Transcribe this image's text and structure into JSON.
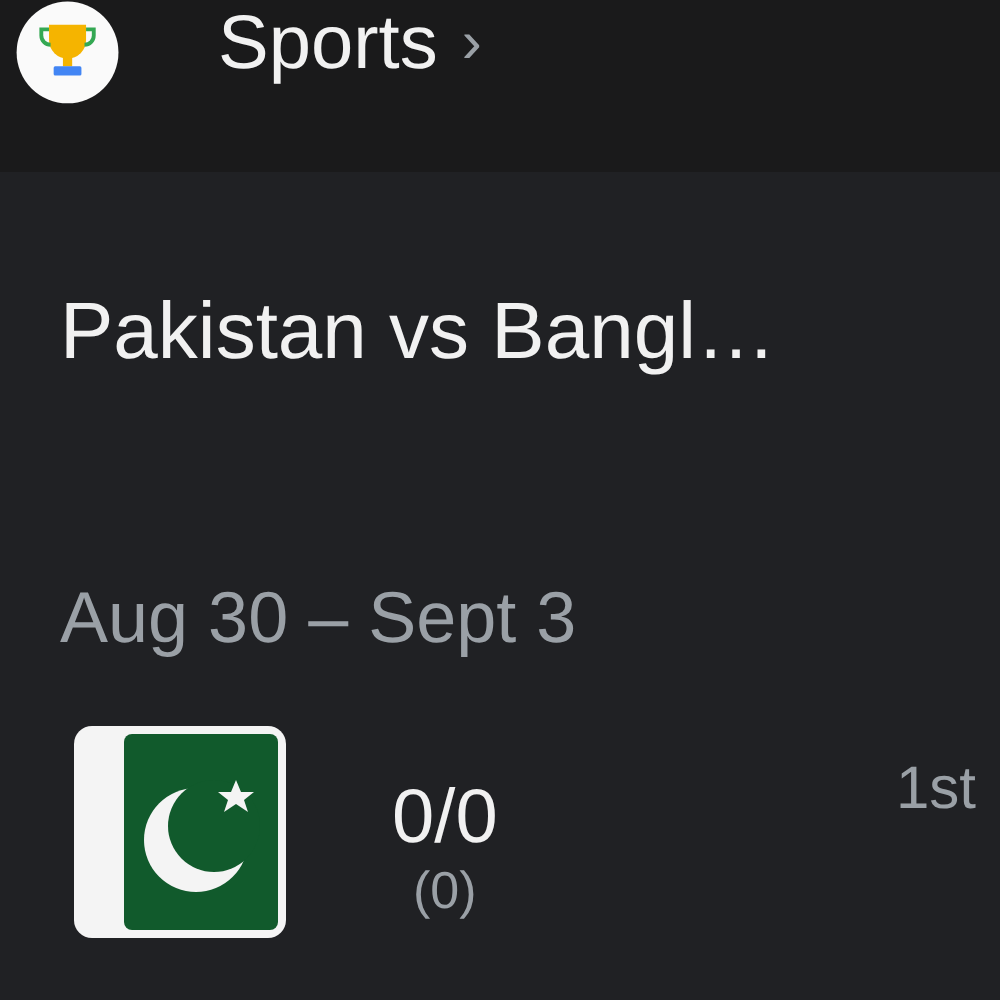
{
  "header": {
    "title": "Sports",
    "chevron": "›"
  },
  "match": {
    "title": "Pakistan vs Bangl…",
    "dates": "Aug 30 – Sept 3"
  },
  "teams": [
    {
      "score": "0/0",
      "overs": "(0)",
      "innings": "1st"
    }
  ]
}
